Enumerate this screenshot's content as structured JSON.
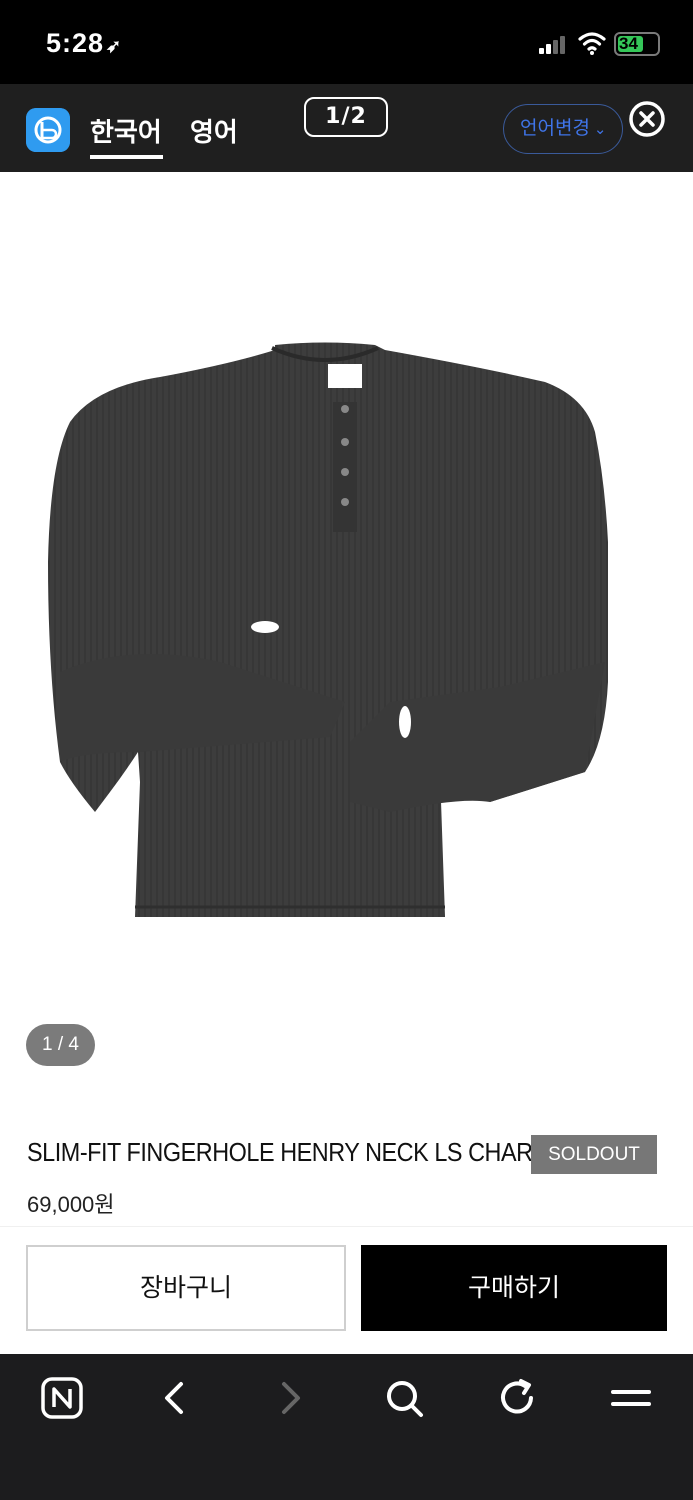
{
  "status_bar": {
    "time": "5:28",
    "battery": "34"
  },
  "translation_bar": {
    "tabs": [
      {
        "label": "한국어",
        "active": true
      },
      {
        "label": "영어",
        "active": false
      }
    ],
    "page_indicator": "1/2",
    "lang_change_label": "언어변경"
  },
  "gallery": {
    "counter": "1 / 4",
    "image_icon": "charcoal-henry-neck-shirt"
  },
  "product": {
    "name": "SLIM-FIT FINGERHOLE HENRY NECK LS CHARCOL",
    "status_badge": "SOLDOUT",
    "price": "69,000원"
  },
  "actions": {
    "cart_label": "장바구니",
    "buy_label": "구매하기"
  },
  "browser_toolbar": {
    "icons": [
      "naver-icon",
      "back-icon",
      "forward-icon",
      "search-icon",
      "reload-icon",
      "menu-icon"
    ]
  },
  "colors": {
    "translation_bar_bg": "#1f1f1f",
    "accent_blue": "#3f74e8",
    "soldout_bg": "#777777",
    "buy_button_bg": "#000000"
  }
}
